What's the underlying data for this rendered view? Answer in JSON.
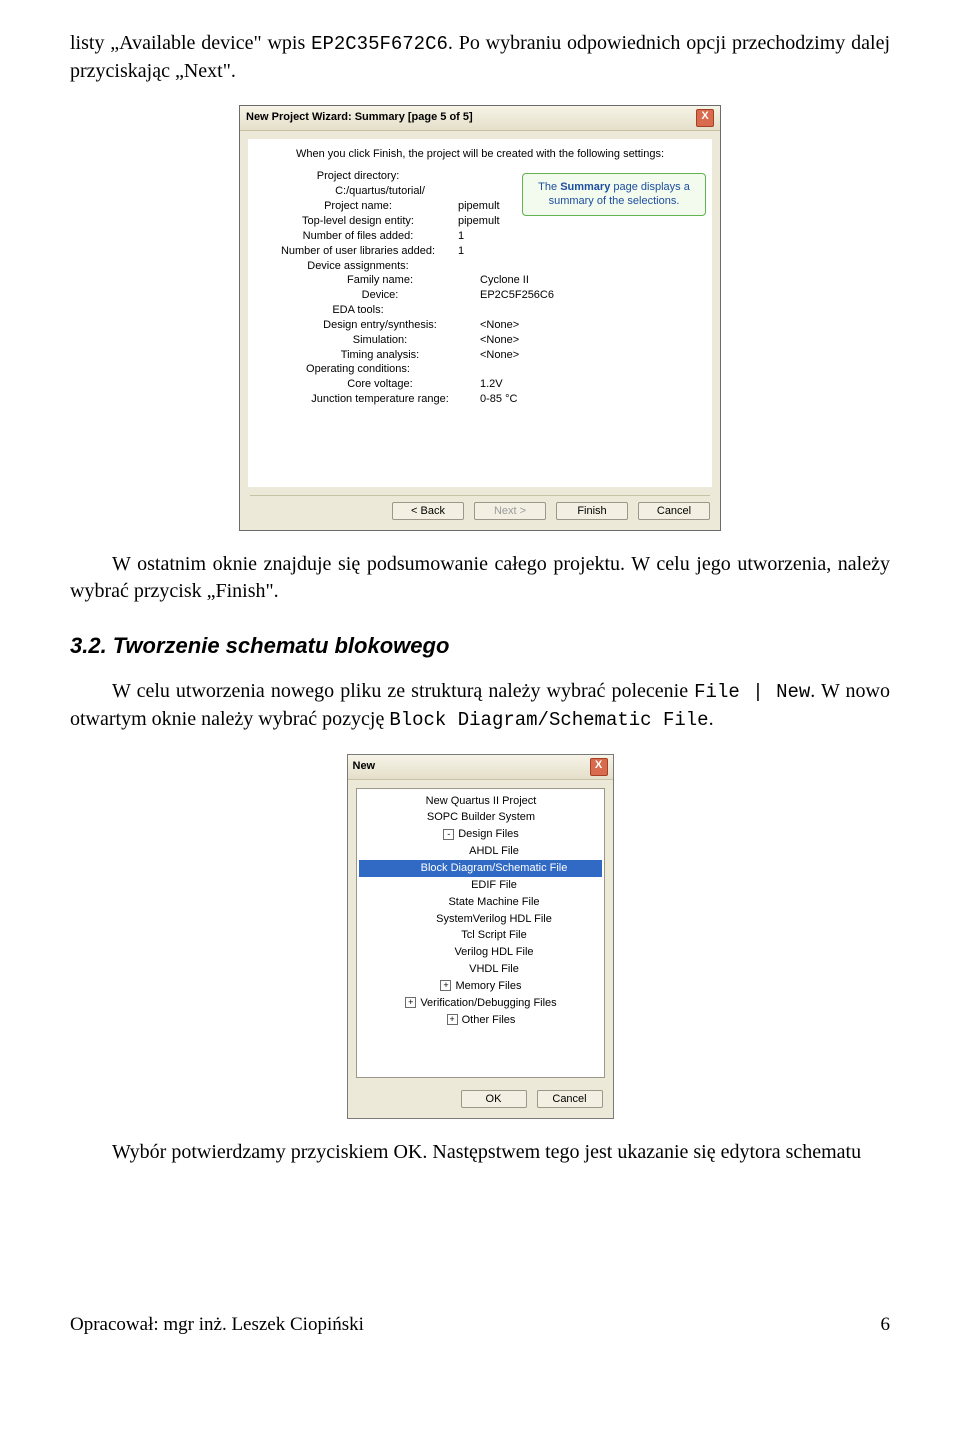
{
  "para1_a": "listy „Available device\" wpis ",
  "para1_code": "EP2C35F672C6",
  "para1_b": ". Po wybraniu odpowiednich opcji przechodzimy dalej przyciskając „Next\".",
  "wizard": {
    "title": "New Project Wizard: Summary [page 5 of 5]",
    "close": "X",
    "intro": "When you click Finish, the project will be created with the following settings:",
    "callout_a": "The ",
    "callout_b": "Summary",
    "callout_c": " page displays a summary of the selections.",
    "rows": [
      {
        "k": "Project directory:",
        "v": ""
      },
      {
        "k": "C:/quartus/tutorial/",
        "v": "",
        "indent": true,
        "keyonly": true
      },
      {
        "k": "Project name:",
        "v": "pipemult"
      },
      {
        "k": "Top-level design entity:",
        "v": "pipemult"
      },
      {
        "k": "Number of files added:",
        "v": "1"
      },
      {
        "k": "Number of user libraries added:",
        "v": "1"
      },
      {
        "k": "Device assignments:",
        "v": ""
      },
      {
        "k": "Family name:",
        "v": "Cyclone II",
        "indent": true
      },
      {
        "k": "Device:",
        "v": "EP2C5F256C6",
        "indent": true
      },
      {
        "k": "EDA tools:",
        "v": ""
      },
      {
        "k": "Design entry/synthesis:",
        "v": "<None>",
        "indent": true
      },
      {
        "k": "Simulation:",
        "v": "<None>",
        "indent": true
      },
      {
        "k": "Timing analysis:",
        "v": "<None>",
        "indent": true
      },
      {
        "k": "Operating conditions:",
        "v": ""
      },
      {
        "k": "Core voltage:",
        "v": "1.2V",
        "indent": true
      },
      {
        "k": "Junction temperature range:",
        "v": "0-85 °C",
        "indent": true
      }
    ],
    "buttons": {
      "back": "< Back",
      "next": "Next >",
      "finish": "Finish",
      "cancel": "Cancel"
    }
  },
  "para2": "W ostatnim oknie znajduje się podsumowanie całego projektu. W celu jego utworzenia, należy wybrać przycisk „Finish\".",
  "section": "3.2. Tworzenie schematu blokowego",
  "para3_a": "W celu utworzenia nowego pliku ze strukturą należy wybrać polecenie ",
  "para3_code": "File | New",
  "para3_b": ". W nowo otwartym oknie należy wybrać pozycję ",
  "para3_code2": "Block Diagram/Schematic File",
  "para3_c": ".",
  "dialog": {
    "title": "New",
    "close": "X",
    "items": [
      {
        "label": "New Quartus II Project",
        "cls": "top"
      },
      {
        "label": "SOPC Builder System",
        "cls": "top"
      },
      {
        "label": "Design Files",
        "cls": "top",
        "box": "-"
      },
      {
        "label": "AHDL File",
        "cls": "sub"
      },
      {
        "label": "Block Diagram/Schematic File",
        "cls": "sel"
      },
      {
        "label": "EDIF File",
        "cls": "sub"
      },
      {
        "label": "State Machine File",
        "cls": "sub"
      },
      {
        "label": "SystemVerilog HDL File",
        "cls": "sub"
      },
      {
        "label": "Tcl Script File",
        "cls": "sub"
      },
      {
        "label": "Verilog HDL File",
        "cls": "sub"
      },
      {
        "label": "VHDL File",
        "cls": "sub"
      },
      {
        "label": "Memory Files",
        "cls": "top",
        "box": "+"
      },
      {
        "label": "Verification/Debugging Files",
        "cls": "top",
        "box": "+"
      },
      {
        "label": "Other Files",
        "cls": "top",
        "box": "+"
      }
    ],
    "buttons": {
      "ok": "OK",
      "cancel": "Cancel"
    }
  },
  "para4": "Wybór potwierdzamy przyciskiem OK. Następstwem tego jest ukazanie się edytora schematu",
  "footer_left": "Opracował: mgr inż. Leszek Ciopiński",
  "footer_page": "6"
}
